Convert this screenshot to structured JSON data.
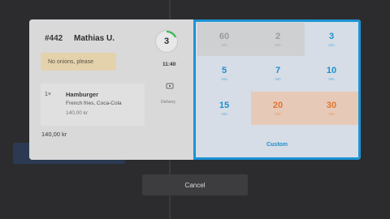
{
  "order": {
    "number": "#442",
    "customer": "Mathias U.",
    "note": "No onions, please",
    "items": [
      {
        "qty": "1×",
        "name": "Hamburger",
        "modifiers": "French fries, Coca-Cola",
        "price": "140,00 kr"
      }
    ],
    "total": "140,00 kr"
  },
  "status": {
    "badge_count": "3",
    "time": "11:40",
    "delivery_label": "Delivery"
  },
  "picker": {
    "unit": "min",
    "options": [
      {
        "value": "60",
        "state": "disabled"
      },
      {
        "value": "2",
        "state": "disabled"
      },
      {
        "value": "3",
        "state": "normal"
      },
      {
        "value": "5",
        "state": "normal"
      },
      {
        "value": "7",
        "state": "normal"
      },
      {
        "value": "10",
        "state": "normal"
      },
      {
        "value": "15",
        "state": "normal"
      },
      {
        "value": "20",
        "state": "warn"
      },
      {
        "value": "30",
        "state": "warn"
      }
    ],
    "custom_label": "Custom"
  },
  "actions": {
    "cancel_label": "Cancel"
  },
  "colors": {
    "accent": "#1b93d4",
    "warning": "#e0752f",
    "note_bg": "#e4d2ad"
  }
}
